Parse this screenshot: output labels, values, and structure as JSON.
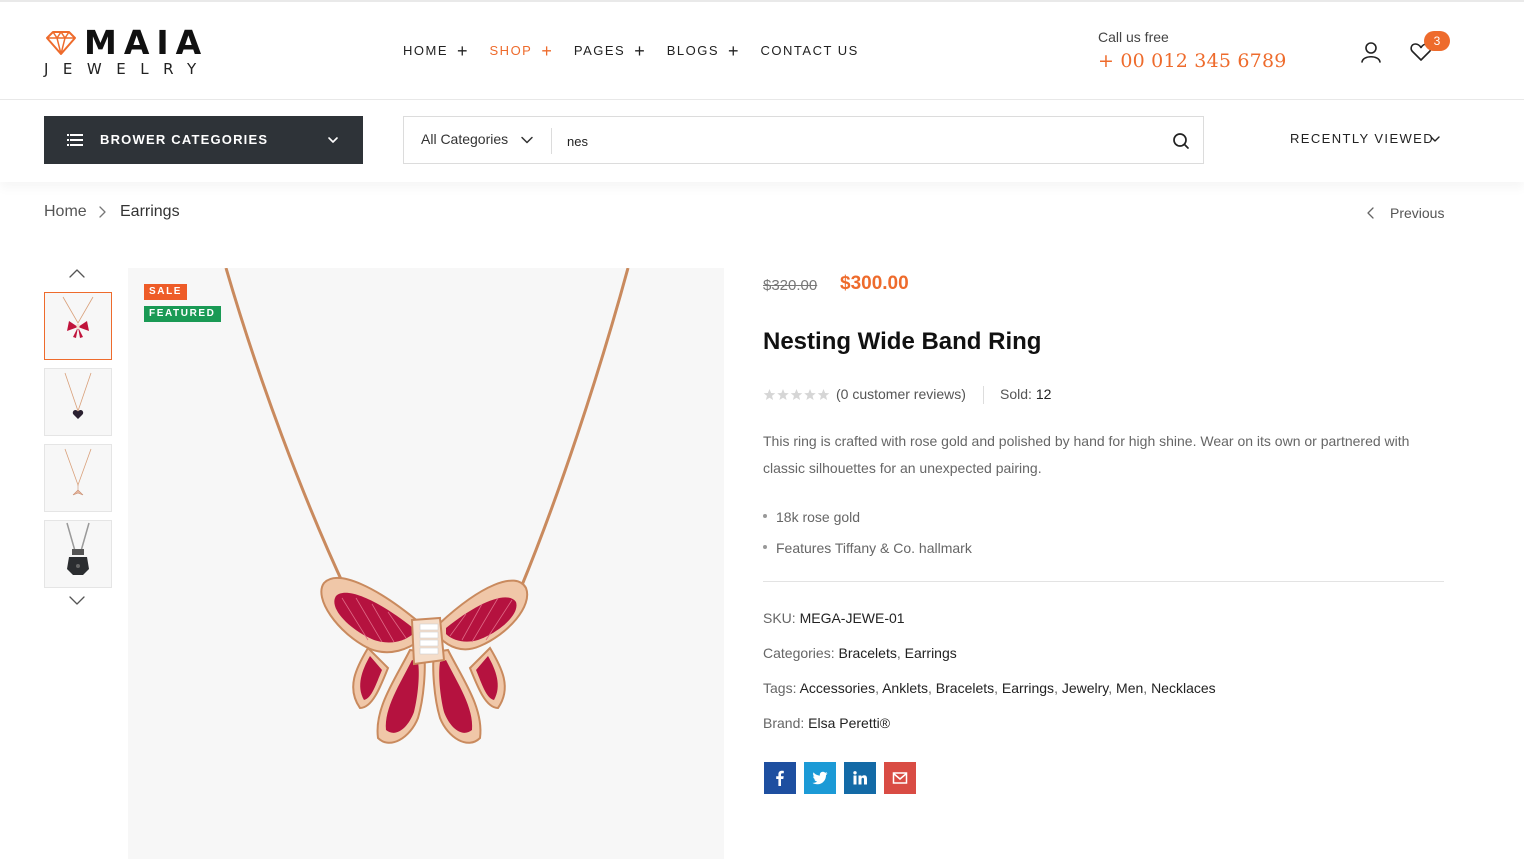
{
  "brand": {
    "name": "MAIA",
    "sub": "JEWELRY"
  },
  "nav": [
    {
      "label": "HOME",
      "active": false
    },
    {
      "label": "SHOP",
      "active": true
    },
    {
      "label": "PAGES",
      "active": false
    },
    {
      "label": "BLOGS",
      "active": false
    },
    {
      "label": "CONTACT US",
      "active": false
    }
  ],
  "contact": {
    "label": "Call us free",
    "phone": "+ 00 012 345 6789"
  },
  "header": {
    "cart_count": "3",
    "user_icon": "user-icon",
    "wishlist_icon": "heart-icon"
  },
  "browse": {
    "label": "BROWER CATEGORIES"
  },
  "search": {
    "category": "All Categories",
    "query": "nes"
  },
  "recently_viewed": "RECENTLY VIEWED",
  "breadcrumb": {
    "home": "Home",
    "current": "Earrings"
  },
  "pager": {
    "previous": "Previous"
  },
  "gallery": {
    "thumbnails": [
      "bow-necklace",
      "heart-pendant",
      "fishtail-pendant",
      "dark-pendant"
    ],
    "active_index": 0,
    "tags": {
      "sale": "SALE",
      "featured": "FEATURED"
    }
  },
  "product": {
    "price_old": "$320.00",
    "price_new": "$300.00",
    "title": "Nesting Wide Band Ring",
    "rating": 0,
    "reviews": "(0 customer reviews)",
    "sold_label": "Sold:",
    "sold_value": "12",
    "description": "This ring is crafted with rose gold and polished by hand for high shine. Wear on its own or partnered with classic silhouettes for an unexpected pairing.",
    "features": [
      "18k rose gold",
      "Features Tiffany & Co. hallmark"
    ],
    "sku_label": "SKU:",
    "sku": "MEGA-JEWE-01",
    "categories_label": "Categories:",
    "categories": [
      "Bracelets",
      "Earrings"
    ],
    "tags_label": "Tags:",
    "tags": [
      "Accessories",
      "Anklets",
      "Bracelets",
      "Earrings",
      "Jewelry",
      "Men",
      "Necklaces"
    ],
    "brand_label": "Brand:",
    "brand": "Elsa Peretti®"
  },
  "share": [
    {
      "name": "facebook",
      "color": "#1e4fa0"
    },
    {
      "name": "twitter",
      "color": "#1c9ad6"
    },
    {
      "name": "linkedin",
      "color": "#136aa6"
    },
    {
      "name": "email",
      "color": "#d94c44"
    }
  ],
  "colors": {
    "accent": "#ee6b2c",
    "dark": "#2e3338",
    "sale": "#ee5c28",
    "featured": "#1a9a55"
  }
}
